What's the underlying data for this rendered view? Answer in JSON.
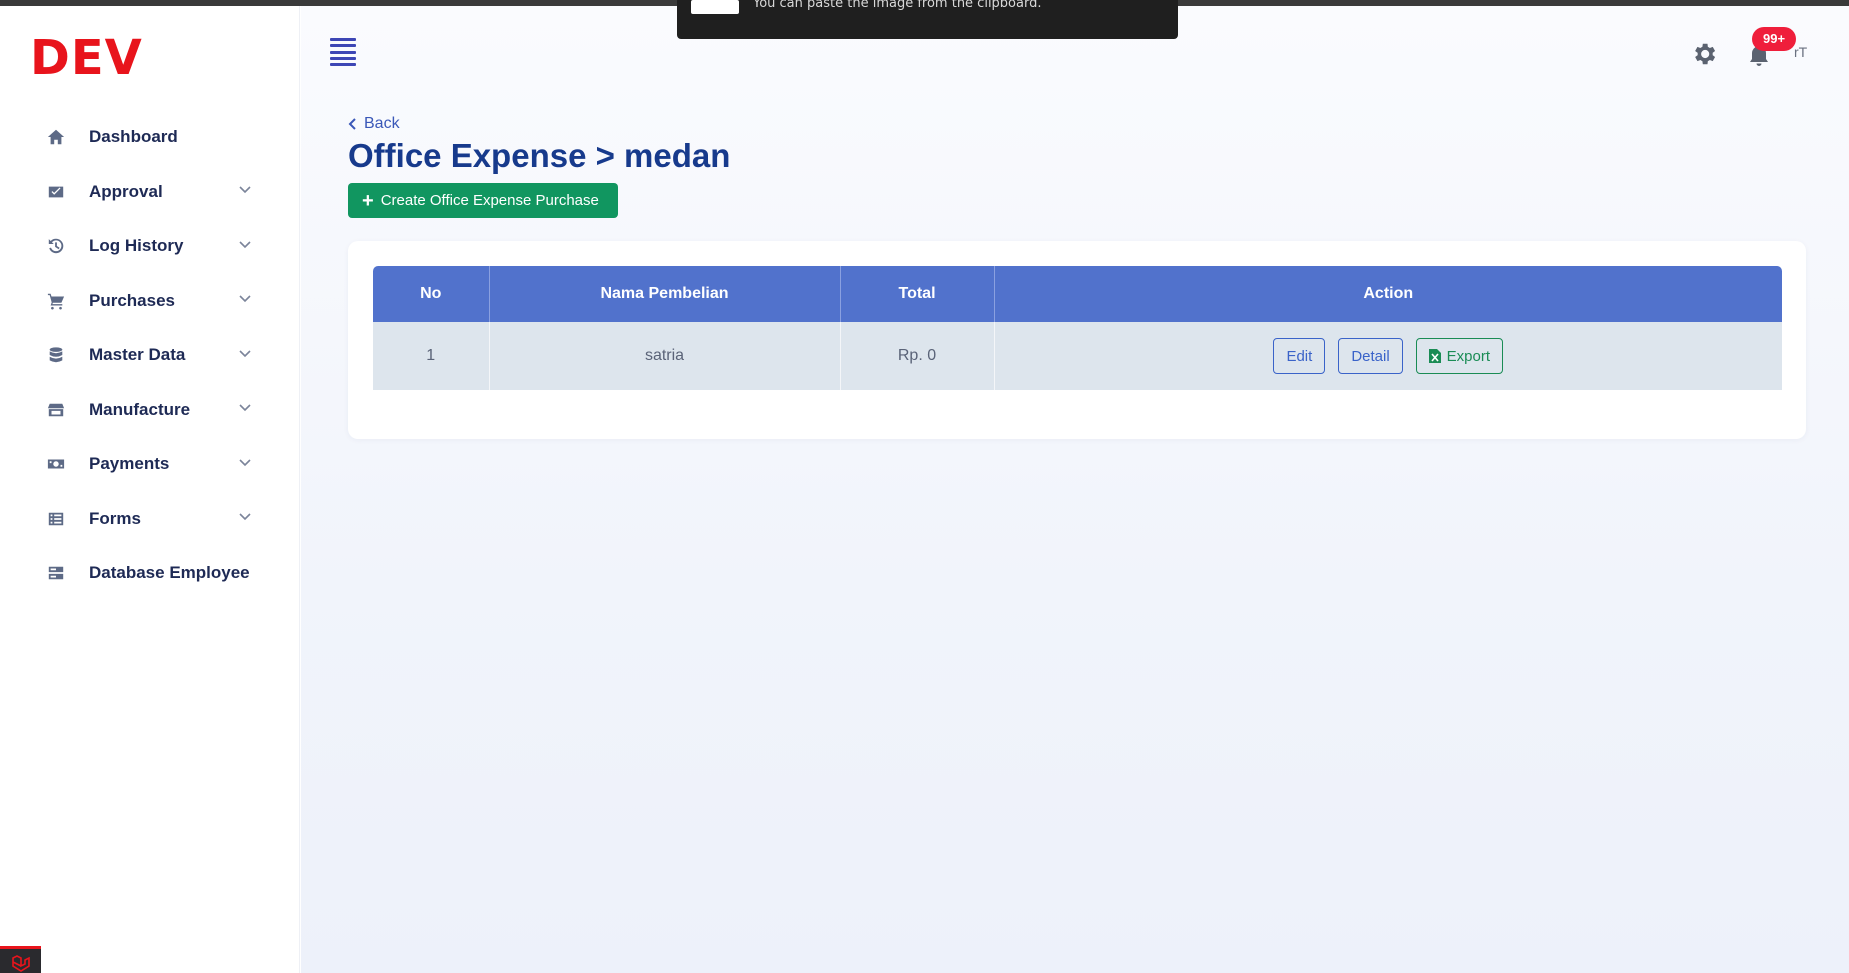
{
  "brand": {
    "logo_text": "DEV",
    "color": "#e8141c"
  },
  "toast": {
    "message": "You can paste the image from the clipboard."
  },
  "sidebar": {
    "items": [
      {
        "label": "Dashboard",
        "icon": "home-icon",
        "expandable": false
      },
      {
        "label": "Approval",
        "icon": "approval-icon",
        "expandable": true
      },
      {
        "label": "Log History",
        "icon": "history-icon",
        "expandable": true
      },
      {
        "label": "Purchases",
        "icon": "cart-icon",
        "expandable": true
      },
      {
        "label": "Master Data",
        "icon": "database-icon",
        "expandable": true
      },
      {
        "label": "Manufacture",
        "icon": "store-icon",
        "expandable": true
      },
      {
        "label": "Payments",
        "icon": "money-icon",
        "expandable": true
      },
      {
        "label": "Forms",
        "icon": "list-icon",
        "expandable": true
      },
      {
        "label": "Database Employee",
        "icon": "server-icon",
        "expandable": false
      }
    ]
  },
  "header": {
    "notification_badge": "99+",
    "user_initial": "rT"
  },
  "page": {
    "back_label": "Back",
    "title": "Office Expense > medan",
    "create_button_label": "Create Office Expense Purchase"
  },
  "table": {
    "headers": [
      "No",
      "Nama Pembelian",
      "Total",
      "Action"
    ],
    "rows": [
      {
        "no": "1",
        "nama": "satria",
        "total": "Rp. 0"
      }
    ],
    "actions": {
      "edit": "Edit",
      "detail": "Detail",
      "export": "Export"
    }
  },
  "colors": {
    "primary_blue": "#5172cc",
    "title_blue": "#173a8c",
    "success_green": "#119660",
    "badge_red": "#ef1e3b"
  }
}
